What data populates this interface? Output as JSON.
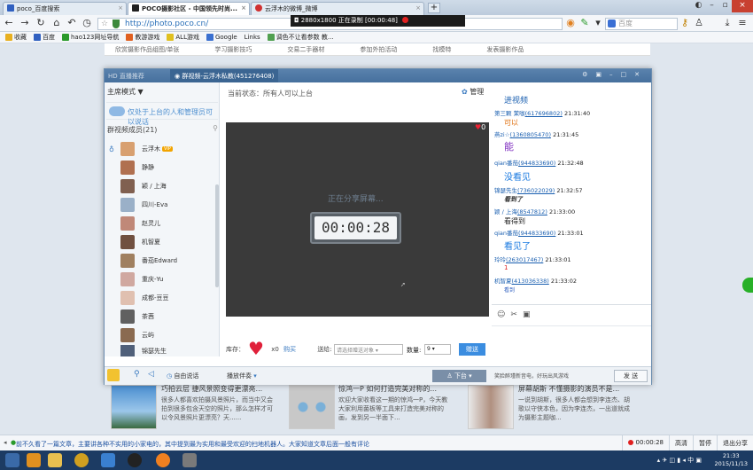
{
  "browser": {
    "tabs": [
      {
        "title": "poco_百度搜索",
        "active": false,
        "color": "#3060c0"
      },
      {
        "title": "POCO摄影社区 - 中国领先时尚...",
        "active": true,
        "color": "#202020"
      },
      {
        "title": "云浮木的微博_微博",
        "active": false,
        "color": "#d03030"
      }
    ],
    "recording_bar": "2880x1800  正在录制 [00:00:48]",
    "url": "http://photo.poco.cn/",
    "search_placeholder": "百度",
    "bookmarks": [
      "收藏",
      "百度",
      "hao123网址导航",
      "教游游戏",
      "ALL游戏",
      "Google",
      "Links",
      "调色不让看参数 教..."
    ]
  },
  "site_nav": [
    "欣赏摄影作品组图/单张",
    "学习摄影技巧",
    "交易二手器材",
    "参加外拍活动",
    "找模特",
    "发表摄影作品"
  ],
  "room": {
    "title_left": "HD 直播推荐",
    "title_tab": "群视频-云浮木私教(451276408)",
    "mode": "主席模式 ▼",
    "notice": "仅处于上台的人和管理员可以说话",
    "group_label": "群视频成员(21)",
    "members": [
      {
        "name": "云浮木",
        "vip": "VIP",
        "color": "#d8a070"
      },
      {
        "name": "静静",
        "color": "#b07050"
      },
      {
        "name": "颖 / 上海",
        "color": "#806050"
      },
      {
        "name": "四川-Eva",
        "color": "#9ab0c8"
      },
      {
        "name": "赵灵儿",
        "color": "#c08878"
      },
      {
        "name": "机智夏",
        "color": "#705040"
      },
      {
        "name": "番茄Edward",
        "color": "#a08060"
      },
      {
        "name": "重庆-Yu",
        "color": "#d0a8a0"
      },
      {
        "name": "成都-豆豆",
        "color": "#e0c0b0"
      },
      {
        "name": "茶茜",
        "color": "#606060"
      },
      {
        "name": "云屿",
        "color": "#8a6a50"
      },
      {
        "name": "锦瑟先生",
        "color": "#50607a"
      }
    ],
    "status": "当前状态：所有人可以上台",
    "manage": "管理",
    "sharing": "正在分享屏幕...",
    "timer": "00:00:28",
    "heart_count": "0",
    "gift": {
      "stock_label": "库存：",
      "count": "x0",
      "buy": "购买",
      "give_label": "送给:",
      "target": "请选择赠送对象",
      "qty_label": "数量:",
      "qty": "9",
      "give_btn": "赠送"
    },
    "chat": [
      {
        "user": "",
        "id": "",
        "time": "",
        "msg": "进视频",
        "msg_color": "#1a5fb0",
        "msg_size": 9
      },
      {
        "user": "第三颗 茉咖",
        "id": "(617696802)",
        "time": "21:31:40",
        "msg": "可以",
        "msg_color": "#e07010",
        "msg_size": 8
      },
      {
        "user": "燕zi☆",
        "id": "(1360805470)",
        "time": "21:31:45",
        "msg": "能",
        "msg_color": "#8030c0",
        "msg_size": 11
      },
      {
        "user": "qian番茄",
        "id": "(944833690)",
        "time": "21:32:48",
        "msg": "没看见",
        "msg_color": "#1a7ae0",
        "msg_size": 10
      },
      {
        "user": "锦瑟先生",
        "id": "(736022029)",
        "time": "21:32:57",
        "msg": "看到了",
        "msg_color": "#333333",
        "msg_size": 7
      },
      {
        "user": "颖 / 上海",
        "id": "(8547812)",
        "time": "21:33:00",
        "msg": "看得到",
        "msg_color": "#222222",
        "msg_size": 8
      },
      {
        "user": "qian番茄",
        "id": "(944833690)",
        "time": "21:33:01",
        "msg": "看见了",
        "msg_color": "#1a7ae0",
        "msg_size": 10
      },
      {
        "user": "玲玲",
        "id": "(263017467)",
        "time": "21:33:01",
        "msg": "1",
        "msg_color": "#e02020",
        "msg_size": 7
      },
      {
        "user": "机智夏",
        "id": "(413036338)",
        "time": "21:33:02",
        "msg": "看到",
        "msg_color": "#3060c0",
        "msg_size": 6
      }
    ],
    "bottom": {
      "free_talk": "自由说话",
      "accompany": "播放伴奏",
      "on_stage": "下台",
      "ad": "笑脸醉瑾新音电，好玩出风游戏",
      "send": "发 送"
    }
  },
  "articles": [
    {
      "title": "巧拍云层 捷风景照变得更漂亮...",
      "body": "很多人都喜欢拍摄风景照片，而当中又会拍到很多包含天空的照片，那么怎样才可以令风景照片更漂亮？天......"
    },
    {
      "title": "惊鸿一P 如何打造完美对称的...",
      "body": "欢迎大家收看这一期的惊鸿一P，今天教大家利用菌板等工具来打造完美对称的画，发到另一半面下..."
    },
    {
      "title": "屏幕胡斯 不懂摄影的演员不是...",
      "body": "一说到胡斯，很多人都会想到李连杰、胡歌以守侠本色，因为李连杰，一出道就成为摄影主题咖..."
    }
  ],
  "status_bar": {
    "ticker": "前不久看了一篇文章，主要讲各种不实用的小家电的，其中提到最为实用和最受欢迎的扫地机器人。大家知道文章后面一般有评论，",
    "rec_time": "00:00:28",
    "hd": "高清",
    "pause": "暂停",
    "exit": "退出分享"
  },
  "taskbar": {
    "tray": "中",
    "time": "21:33",
    "date": "2015/11/13"
  },
  "colors": {
    "accent": "#3b8de0",
    "title_bar": "#4a74a2",
    "record": "#e02020"
  }
}
